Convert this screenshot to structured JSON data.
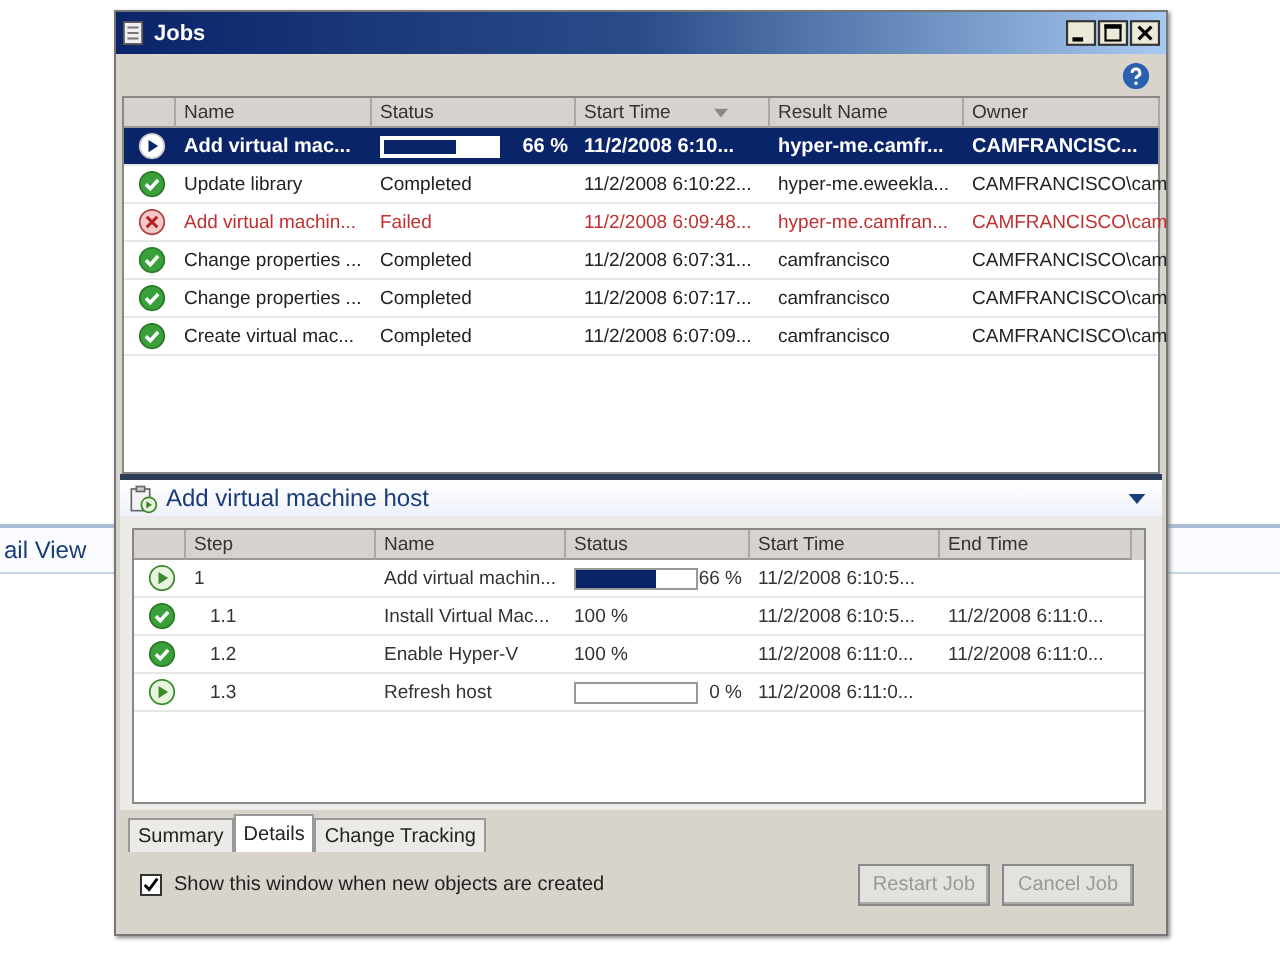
{
  "background": {
    "label": "ail View"
  },
  "window": {
    "title": "Jobs"
  },
  "jobs": {
    "columns": [
      {
        "label": "Name"
      },
      {
        "label": "Status"
      },
      {
        "label": "Start Time",
        "sorted": true
      },
      {
        "label": "Result Name"
      },
      {
        "label": "Owner"
      }
    ],
    "rows": [
      {
        "kind": "running",
        "selected": true,
        "name": "Add virtual mac...",
        "level": 0.66,
        "reading": "66 %",
        "start": "11/2/2008 6:10...",
        "result": "hyper-me.camfr...",
        "owner": "CAMFRANCISC..."
      },
      {
        "kind": "completed",
        "selected": false,
        "name": "Update library",
        "status": "Completed",
        "start": "11/2/2008 6:10:22...",
        "result": "hyper-me.eweekla...",
        "owner": "CAMFRANCISCO\\cam"
      },
      {
        "kind": "failed",
        "selected": false,
        "name": "Add virtual machin...",
        "status": "Failed",
        "start": "11/2/2008 6:09:48...",
        "result": "hyper-me.camfran...",
        "owner": "CAMFRANCISCO\\cam"
      },
      {
        "kind": "completed",
        "selected": false,
        "name": "Change properties ...",
        "status": "Completed",
        "start": "11/2/2008 6:07:31...",
        "result": "camfrancisco",
        "owner": "CAMFRANCISCO\\cam"
      },
      {
        "kind": "completed",
        "selected": false,
        "name": "Change properties ...",
        "status": "Completed",
        "start": "11/2/2008 6:07:17...",
        "result": "camfrancisco",
        "owner": "CAMFRANCISCO\\cam"
      },
      {
        "kind": "completed",
        "selected": false,
        "name": "Create virtual mac...",
        "status": "Completed",
        "start": "11/2/2008 6:07:09...",
        "result": "camfrancisco",
        "owner": "CAMFRANCISCO\\cam"
      }
    ]
  },
  "details": {
    "title": "Add virtual machine host",
    "columns": [
      {
        "label": "Step"
      },
      {
        "label": "Name"
      },
      {
        "label": "Status"
      },
      {
        "label": "Start Time"
      },
      {
        "label": "End Time"
      }
    ],
    "steps": [
      {
        "kind": "running",
        "step": "1",
        "name": "Add virtual machin...",
        "level": 0.66,
        "reading": "66 %",
        "start": "11/2/2008 6:10:5...",
        "children": [
          {
            "kind": "completed",
            "step": "1.1",
            "name": "Install Virtual Mac...",
            "status": "100 %",
            "start": "11/2/2008 6:10:5...",
            "end": "11/2/2008 6:11:0..."
          },
          {
            "kind": "completed",
            "step": "1.2",
            "name": "Enable Hyper-V",
            "status": "100 %",
            "start": "11/2/2008 6:11:0...",
            "end": "11/2/2008 6:11:0..."
          },
          {
            "kind": "running",
            "step": "1.3",
            "name": "Refresh host",
            "level": 0,
            "reading": "0 %",
            "start": "11/2/2008 6:11:0..."
          }
        ]
      }
    ]
  },
  "tabs": [
    {
      "label": "Summary",
      "selected": false
    },
    {
      "label": "Details",
      "selected": true
    },
    {
      "label": "Change Tracking",
      "selected": false
    }
  ],
  "show_window": {
    "label": "Show this window when new objects are created",
    "checked": true
  },
  "buttons": [
    {
      "label": "Restart Job",
      "disabled": true
    },
    {
      "label": "Cancel Job",
      "disabled": true
    }
  ]
}
